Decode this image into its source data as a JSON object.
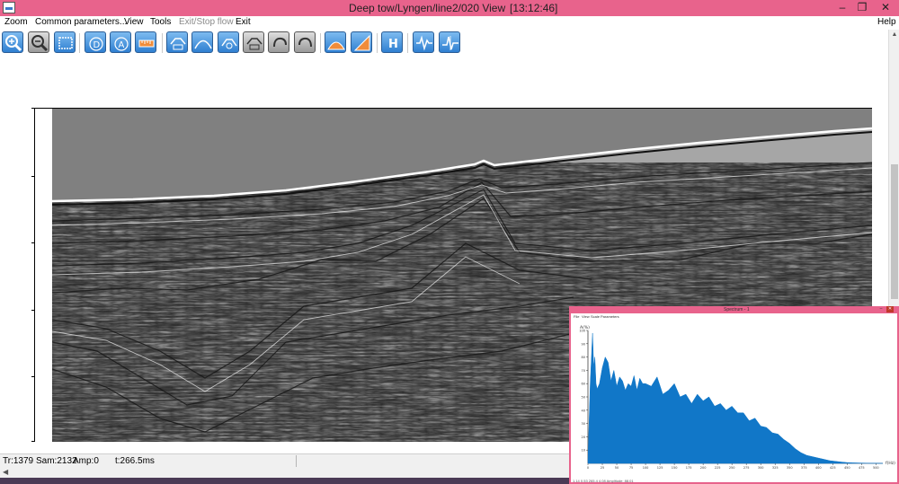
{
  "window": {
    "title": "Deep tow/Lyngen/line2/020 View",
    "time": "[13:12:46]",
    "minimize": "–",
    "restore": "❐",
    "close": "✕"
  },
  "menu": {
    "items": [
      "Zoom",
      "Common parameters...",
      "View",
      "Tools",
      "Exit/Stop flow",
      "Exit"
    ],
    "help": "Help"
  },
  "toolbar": {
    "buttons": [
      {
        "name": "zoom-in",
        "icon": "magnifier-plus-icon"
      },
      {
        "name": "zoom-out",
        "icon": "magnifier-minus-icon"
      },
      {
        "name": "zoom-fit",
        "icon": "frame-icon"
      },
      {
        "name": "mode-d",
        "icon": "letter-d-icon",
        "label": "D"
      },
      {
        "name": "mode-a",
        "icon": "letter-a-icon",
        "label": "A"
      },
      {
        "name": "ruler",
        "icon": "ruler-icon"
      },
      {
        "name": "horizon-pick",
        "icon": "horizon-pick-icon"
      },
      {
        "name": "horizon-curve",
        "icon": "curve-icon"
      },
      {
        "name": "horizon-edit",
        "icon": "horizon-edit-icon"
      },
      {
        "name": "horizon-save",
        "icon": "horizon-save-icon"
      },
      {
        "name": "undo",
        "icon": "undo-icon"
      },
      {
        "name": "redo",
        "icon": "redo-icon"
      },
      {
        "name": "fill-area",
        "icon": "fill-icon"
      },
      {
        "name": "gain",
        "icon": "gain-icon"
      },
      {
        "name": "header",
        "icon": "letter-h-icon",
        "label": "H"
      },
      {
        "name": "trace-wiggle",
        "icon": "wiggle-icon"
      },
      {
        "name": "spectrum",
        "icon": "spectrum-icon"
      }
    ]
  },
  "status": {
    "trace": "Tr:1379",
    "sample": "Sam:2132",
    "amplitude": "Amp:0",
    "time": "t:266.5ms"
  },
  "spectrum": {
    "title": "Spectrum - 1",
    "menu": [
      "File",
      "View",
      "Scale",
      "Parameters"
    ],
    "status": "1.14  0.53  265.4   4.08      Amplitude: 88.01",
    "colors": {
      "fill": "#1177c8",
      "window_border": "#e8638c"
    }
  },
  "chart_data": {
    "type": "area",
    "ylabel": "A(%)",
    "xlabel": "f(Hz)",
    "xlim": [
      0,
      512
    ],
    "ylim": [
      0,
      100
    ],
    "y_ticks": [
      10,
      20,
      30,
      40,
      50,
      60,
      70,
      80,
      90,
      100
    ],
    "x_ticks": [
      0,
      25,
      50,
      75,
      100,
      125,
      150,
      175,
      200,
      225,
      250,
      275,
      300,
      325,
      350,
      375,
      400,
      425,
      450,
      475,
      500
    ],
    "x": [
      0,
      4,
      8,
      10,
      12,
      14,
      16,
      20,
      25,
      30,
      35,
      40,
      45,
      50,
      55,
      60,
      65,
      70,
      75,
      80,
      85,
      90,
      95,
      100,
      110,
      120,
      130,
      140,
      150,
      160,
      170,
      180,
      190,
      200,
      210,
      220,
      230,
      240,
      250,
      260,
      270,
      280,
      290,
      300,
      310,
      320,
      330,
      340,
      350,
      360,
      370,
      380,
      390,
      400,
      410,
      420,
      430,
      440,
      450,
      460,
      470,
      480,
      490,
      500,
      512
    ],
    "values": [
      2,
      60,
      98,
      72,
      80,
      60,
      56,
      60,
      72,
      80,
      76,
      62,
      70,
      58,
      65,
      62,
      55,
      60,
      58,
      66,
      55,
      64,
      60,
      60,
      58,
      65,
      52,
      55,
      60,
      50,
      52,
      45,
      52,
      47,
      50,
      43,
      45,
      40,
      43,
      38,
      38,
      32,
      34,
      28,
      27,
      23,
      22,
      18,
      15,
      11,
      8,
      6,
      5,
      4,
      3,
      2,
      1.5,
      1,
      0.6,
      0.4,
      0.3,
      0.2,
      0.1,
      0.1,
      0
    ]
  }
}
